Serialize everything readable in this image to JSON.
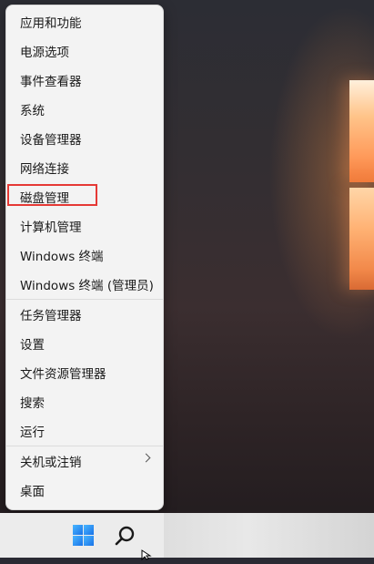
{
  "menu": {
    "items": [
      {
        "label": "应用和功能"
      },
      {
        "label": "电源选项"
      },
      {
        "label": "事件查看器"
      },
      {
        "label": "系统"
      },
      {
        "label": "设备管理器"
      },
      {
        "label": "网络连接"
      },
      {
        "label": "磁盘管理",
        "highlighted": true,
        "highlight_color": "#e53935"
      },
      {
        "label": "计算机管理"
      },
      {
        "label": "Windows 终端"
      },
      {
        "label": "Windows 终端 (管理员)"
      },
      {
        "label": "任务管理器"
      },
      {
        "label": "设置"
      },
      {
        "label": "文件资源管理器"
      },
      {
        "label": "搜索"
      },
      {
        "label": "运行"
      },
      {
        "label": "关机或注销",
        "has_submenu": true
      },
      {
        "label": "桌面"
      }
    ]
  },
  "taskbar": {
    "start_icon": "windows-start-icon",
    "search_icon": "search-icon"
  },
  "colors": {
    "menu_background": "#f3f3f3",
    "highlight_box": "#e53935",
    "start_icon": "#1a73e8",
    "taskbar": "#ececec"
  }
}
